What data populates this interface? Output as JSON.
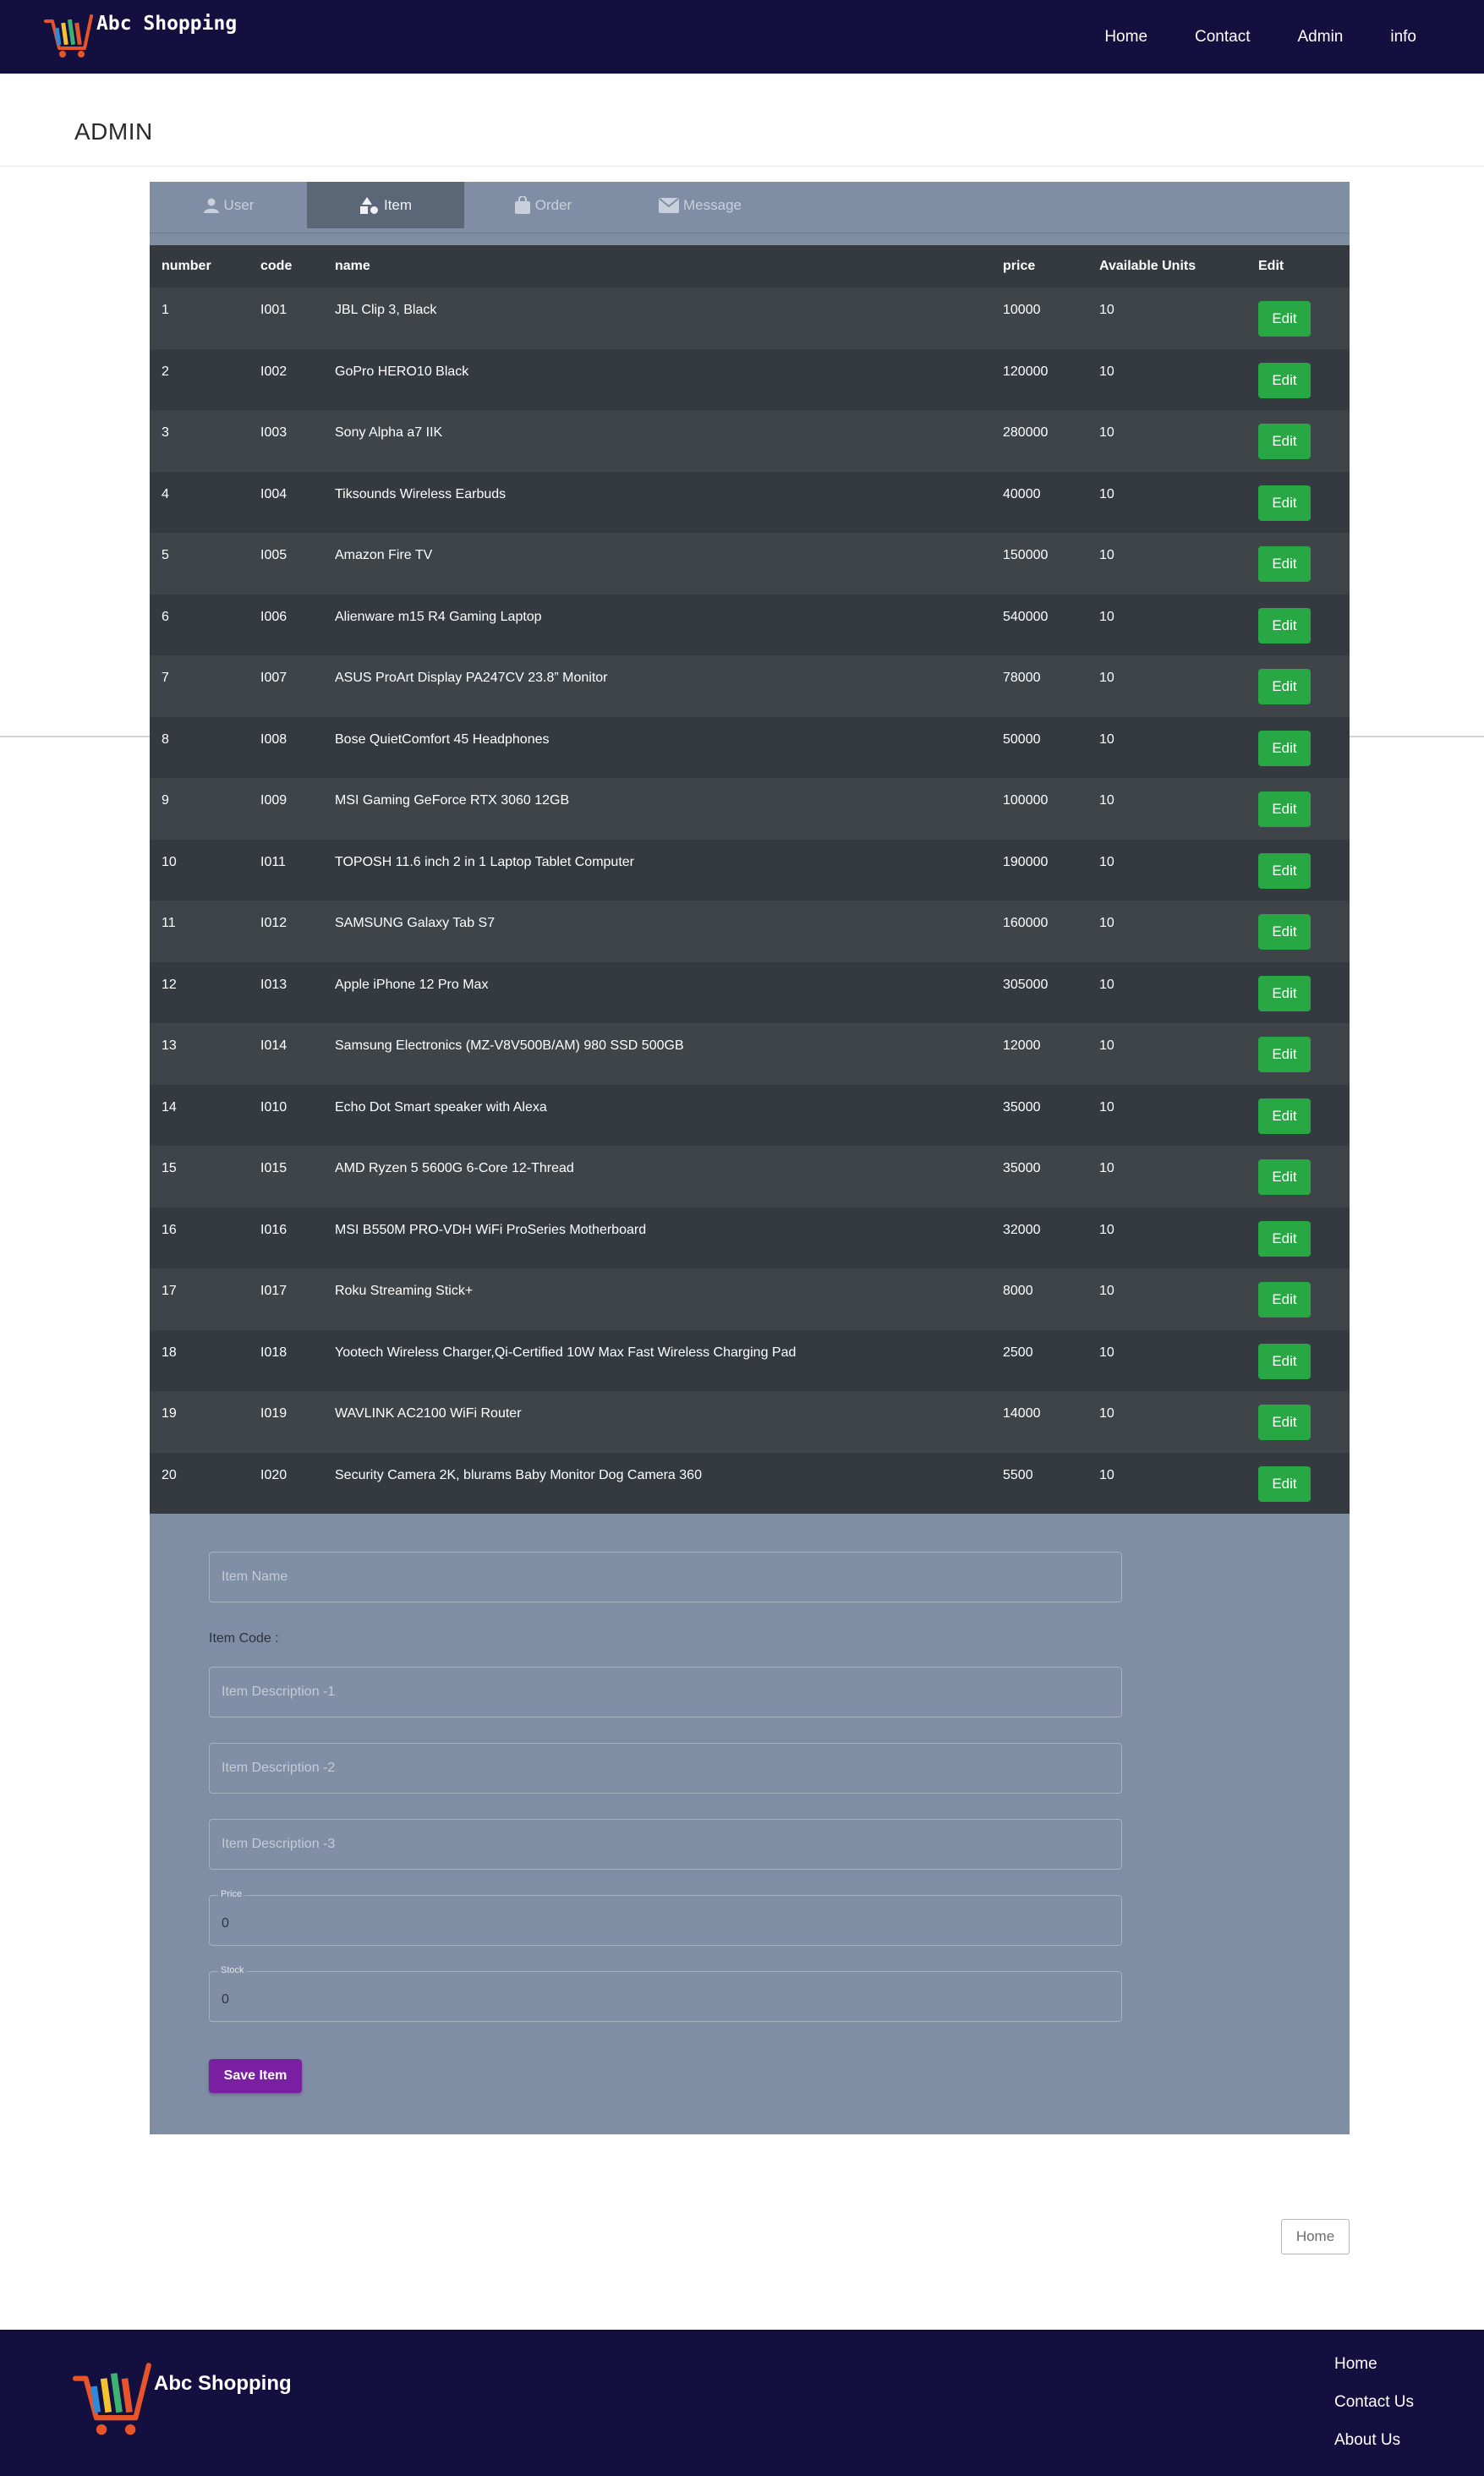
{
  "brand": {
    "name": "Abc Shopping"
  },
  "nav": [
    "Home",
    "Contact",
    "Admin",
    "info"
  ],
  "page_title": "ADMIN",
  "tabs": [
    {
      "label": "User",
      "icon": "user-icon",
      "active": false
    },
    {
      "label": "Item",
      "icon": "shapes-icon",
      "active": true
    },
    {
      "label": "Order",
      "icon": "bag-icon",
      "active": false
    },
    {
      "label": "Message",
      "icon": "mail-icon",
      "active": false
    }
  ],
  "table": {
    "headers": [
      "number",
      "code",
      "name",
      "price",
      "Available Units",
      "Edit"
    ],
    "edit_label": "Edit",
    "rows": [
      [
        "1",
        "I001",
        "JBL Clip 3, Black",
        "10000",
        "10"
      ],
      [
        "2",
        "I002",
        "GoPro HERO10 Black",
        "120000",
        "10"
      ],
      [
        "3",
        "I003",
        "Sony Alpha a7 IIK",
        "280000",
        "10"
      ],
      [
        "4",
        "I004",
        "Tiksounds Wireless Earbuds",
        "40000",
        "10"
      ],
      [
        "5",
        "I005",
        "Amazon Fire TV",
        "150000",
        "10"
      ],
      [
        "6",
        "I006",
        "Alienware m15 R4 Gaming Laptop",
        "540000",
        "10"
      ],
      [
        "7",
        "I007",
        "ASUS ProArt Display PA247CV 23.8” Monitor",
        "78000",
        "10"
      ],
      [
        "8",
        "I008",
        "Bose QuietComfort 45 Headphones",
        "50000",
        "10"
      ],
      [
        "9",
        "I009",
        "MSI Gaming GeForce RTX 3060 12GB",
        "100000",
        "10"
      ],
      [
        "10",
        "I011",
        "TOPOSH 11.6 inch 2 in 1 Laptop Tablet Computer",
        "190000",
        "10"
      ],
      [
        "11",
        "I012",
        "SAMSUNG Galaxy Tab S7",
        "160000",
        "10"
      ],
      [
        "12",
        "I013",
        "Apple iPhone 12 Pro Max",
        "305000",
        "10"
      ],
      [
        "13",
        "I014",
        "Samsung Electronics (MZ-V8V500B/AM) 980 SSD 500GB",
        "12000",
        "10"
      ],
      [
        "14",
        "I010",
        "Echo Dot Smart speaker with Alexa",
        "35000",
        "10"
      ],
      [
        "15",
        "I015",
        "AMD Ryzen 5 5600G 6-Core 12-Thread",
        "35000",
        "10"
      ],
      [
        "16",
        "I016",
        "MSI B550M PRO-VDH WiFi ProSeries Motherboard",
        "32000",
        "10"
      ],
      [
        "17",
        "I017",
        "Roku Streaming Stick+",
        "8000",
        "10"
      ],
      [
        "18",
        "I018",
        "Yootech Wireless Charger,Qi-Certified 10W Max Fast Wireless Charging Pad",
        "2500",
        "10"
      ],
      [
        "19",
        "I019",
        "WAVLINK AC2100 WiFi Router",
        "14000",
        "10"
      ],
      [
        "20",
        "I020",
        "Security Camera 2K, blurams Baby Monitor Dog Camera 360",
        "5500",
        "10"
      ]
    ]
  },
  "form": {
    "item_name_placeholder": "Item Name",
    "item_code_label": "Item Code :",
    "desc1_placeholder": "Item Description -1",
    "desc2_placeholder": "Item Description -2",
    "desc3_placeholder": "Item Description -3",
    "price_label": "Price",
    "price_value": "0",
    "stock_label": "Stock",
    "stock_value": "0",
    "save_label": "Save Item"
  },
  "home_button": "Home",
  "footer": {
    "brand": "Abc Shopping",
    "links": [
      "Home",
      "Contact Us",
      "About Us"
    ]
  },
  "colors": {
    "navbar": "#130f3f",
    "panel": "#7f8da5",
    "table_dark": "#343a40",
    "edit_green": "#28a745",
    "save_purple": "#7b1fa2"
  }
}
